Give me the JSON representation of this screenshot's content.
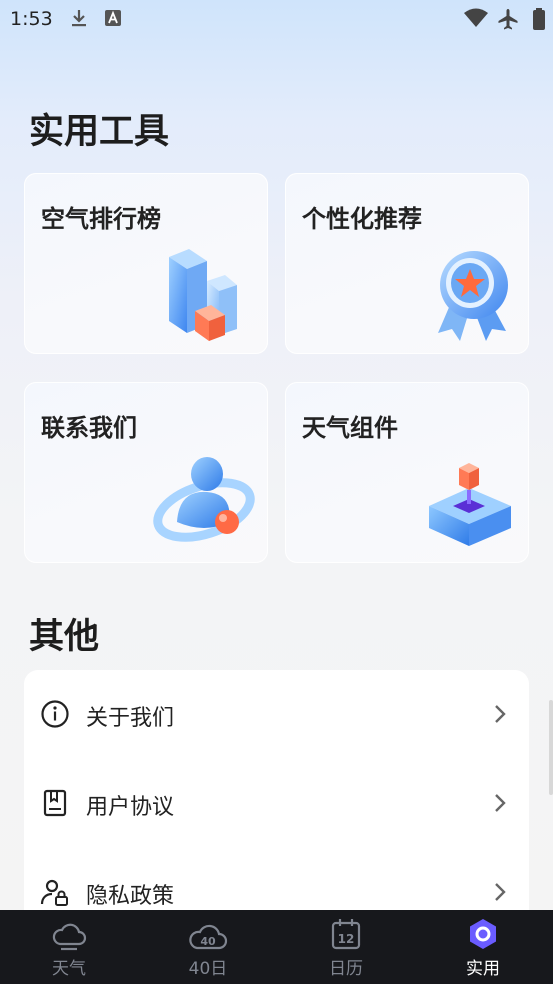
{
  "status_bar": {
    "time": "1:53"
  },
  "tools_section": {
    "title": "实用工具",
    "cards": [
      {
        "label": "空气排行榜",
        "icon": "bar-blocks-icon"
      },
      {
        "label": "个性化推荐",
        "icon": "medal-star-icon"
      },
      {
        "label": "联系我们",
        "icon": "person-orbit-icon"
      },
      {
        "label": "天气组件",
        "icon": "cube-widget-icon"
      }
    ]
  },
  "other_section": {
    "title": "其他",
    "items": [
      {
        "label": "关于我们",
        "icon": "info-icon"
      },
      {
        "label": "用户协议",
        "icon": "document-icon"
      },
      {
        "label": "隐私政策",
        "icon": "user-lock-icon"
      }
    ]
  },
  "tab_bar": {
    "tabs": [
      {
        "label": "天气",
        "icon": "cloud-icon"
      },
      {
        "label": "40日",
        "icon": "cloud-40-icon",
        "icon_text": "40"
      },
      {
        "label": "日历",
        "icon": "calendar-icon",
        "icon_text": "12"
      },
      {
        "label": "实用",
        "icon": "tools-ring-icon"
      }
    ],
    "active_index": 3
  },
  "colors": {
    "accent": "#6a5cff",
    "tab_bar_bg": "#17181c",
    "inactive_tab": "#808590"
  }
}
